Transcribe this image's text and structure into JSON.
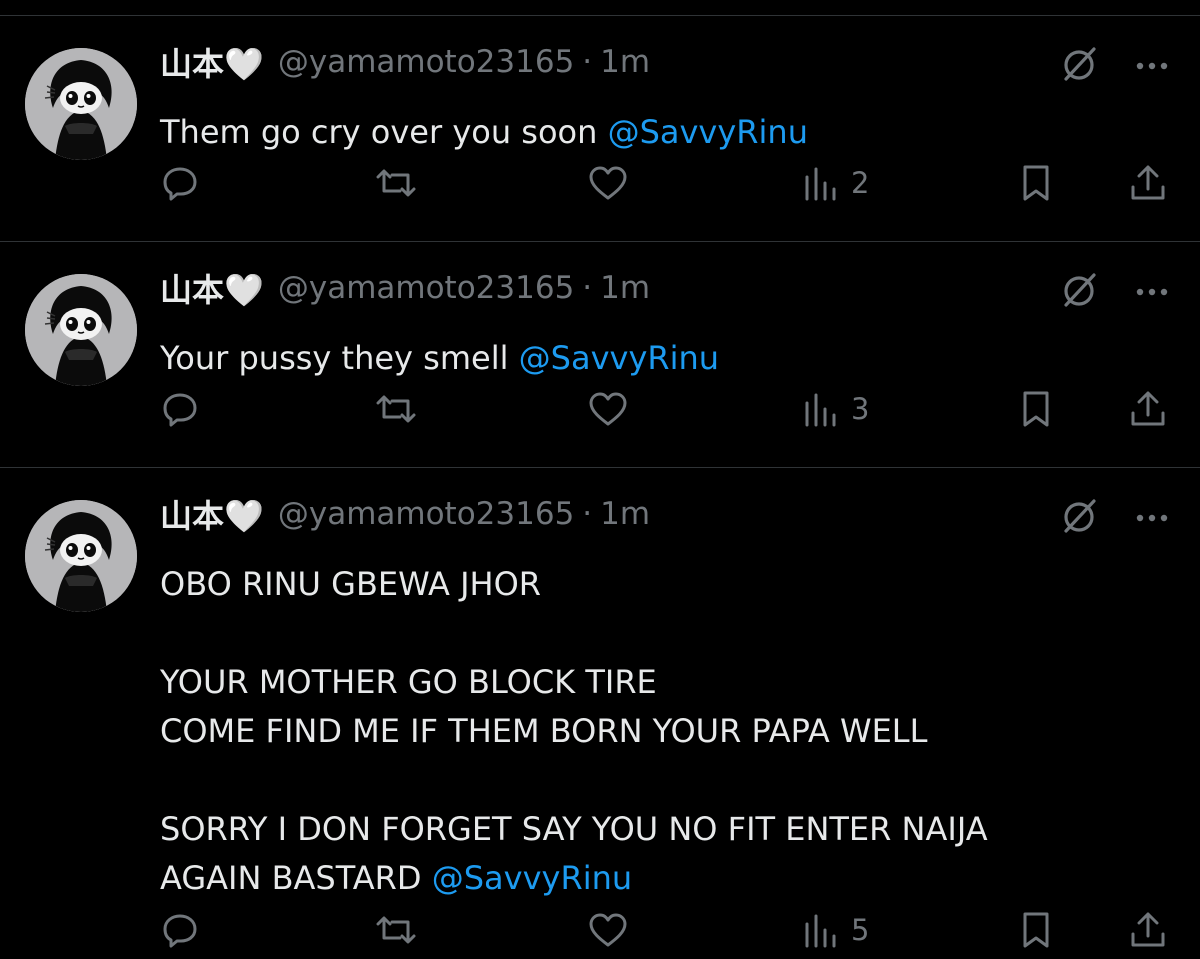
{
  "colors": {
    "background": "#000000",
    "text": "#e7e9ea",
    "muted": "#71767b",
    "mention": "#1d9bf0",
    "divider": "#2f3336"
  },
  "tweets": [
    {
      "display_name": "山本🤍",
      "handle": "@yamamoto23165",
      "separator": "·",
      "time": "1m",
      "text": "Them go cry over you soon ",
      "mention": "@SavvyRinu",
      "views": "2",
      "icons": [
        "grok-icon",
        "more-icon",
        "reply-icon",
        "retweet-icon",
        "like-icon",
        "views-icon",
        "bookmark-icon",
        "share-icon"
      ]
    },
    {
      "display_name": "山本🤍",
      "handle": "@yamamoto23165",
      "separator": "·",
      "time": "1m",
      "text": "Your pussy they smell ",
      "mention": "@SavvyRinu",
      "views": "3",
      "icons": [
        "grok-icon",
        "more-icon",
        "reply-icon",
        "retweet-icon",
        "like-icon",
        "views-icon",
        "bookmark-icon",
        "share-icon"
      ]
    },
    {
      "display_name": "山本🤍",
      "handle": "@yamamoto23165",
      "separator": "·",
      "time": "1m",
      "text": "OBO RINU GBEWA JHOR\n\nYOUR MOTHER GO BLOCK TIRE\nCOME FIND ME IF THEM BORN YOUR PAPA WELL\n\nSORRY I DON FORGET SAY YOU NO FIT ENTER NAIJA\nAGAIN BASTARD ",
      "mention": "@SavvyRinu",
      "views": "5",
      "icons": [
        "grok-icon",
        "more-icon",
        "reply-icon",
        "retweet-icon",
        "like-icon",
        "views-icon",
        "bookmark-icon",
        "share-icon"
      ]
    }
  ]
}
